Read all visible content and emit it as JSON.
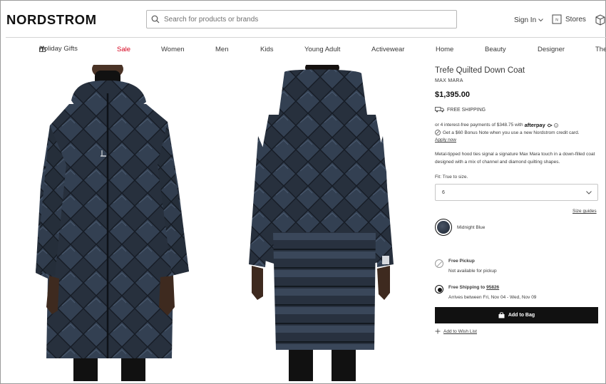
{
  "header": {
    "logo": "NORDSTROM",
    "search_placeholder": "Search for products or brands",
    "sign_in": "Sign In",
    "stores": "Stores"
  },
  "nav": {
    "items": [
      "Holiday Gifts",
      "Sale",
      "Women",
      "Men",
      "Kids",
      "Young Adult",
      "Activewear",
      "Home",
      "Beauty",
      "Designer",
      "The"
    ]
  },
  "product": {
    "title": "Trefe Quilted Down Coat",
    "brand": "MAX MARA",
    "price": "$1,395.00",
    "free_shipping": "FREE SHIPPING",
    "afterpay_text": "or 4 interest-free payments of $348.75 with",
    "afterpay_brand": "afterpay",
    "bonus_note": "Get a $60 Bonus Note when you use a new Nordstrom credit card.",
    "apply_now": "Apply now",
    "description": "Metal-tipped hood ties signal a signature Max Mara touch in a down-filled coat designed with a mix of channel and diamond quilting shapes.",
    "fit_label": "Fit:",
    "fit_value": "True to size.",
    "size_selected": "6",
    "size_guides": "Size guides",
    "color_name": "Midnight Blue",
    "swatch_color": "#1c2430",
    "pickup_title": "Free Pickup",
    "pickup_sub": "Not available for pickup",
    "shipping_title": "Free Shipping to",
    "shipping_zip": "95826",
    "shipping_sub": "Arrives between Fri, Nov 04 - Wed, Nov 09",
    "add_to_bag": "Add to Bag",
    "add_to_wishlist": "Add to Wish List"
  },
  "colors": {
    "sale": "#d6001c",
    "button": "#111111"
  }
}
